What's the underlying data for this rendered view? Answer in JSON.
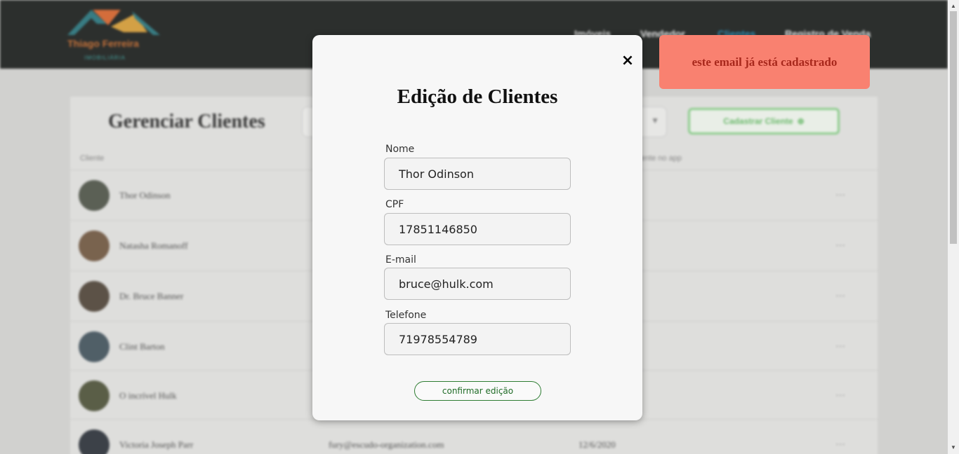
{
  "header": {
    "logo_text": "Thiago Ferreira",
    "logo_sub": "IMOBILIÁRIA",
    "nav": [
      {
        "label": "Imóveis",
        "active": false
      },
      {
        "label": "Vendedor",
        "active": false
      },
      {
        "label": "Clientes",
        "active": true
      },
      {
        "label": "Registro de Venda",
        "active": false
      }
    ]
  },
  "page": {
    "title": "Gerenciar Clientes",
    "add_button": "Cadastrar Cliente",
    "columns": [
      "Cliente",
      "",
      "Cliente no app"
    ]
  },
  "clients": [
    {
      "name": "Thor Odinson",
      "email": "",
      "date": ""
    },
    {
      "name": "Natasha Romanoff",
      "email": "",
      "date": ""
    },
    {
      "name": "Dr. Bruce Banner",
      "email": "",
      "date": ""
    },
    {
      "name": "Clint Barton",
      "email": "",
      "date": ""
    },
    {
      "name": "O incrível Hulk",
      "email": "",
      "date": ""
    },
    {
      "name": "Victoria Joseph Parr",
      "email": "fury@escudo-organization.com",
      "date": "12/6/2020"
    }
  ],
  "modal": {
    "close": "×",
    "title": "Edição de Clientes",
    "fields": {
      "nome": {
        "label": "Nome",
        "value": "Thor Odinson"
      },
      "cpf": {
        "label": "CPF",
        "value": "17851146850"
      },
      "email": {
        "label": "E-mail",
        "value": "bruce@hulk.com"
      },
      "telefone": {
        "label": "Telefone",
        "value": "71978554789"
      }
    },
    "confirm_button": "confirmar edição"
  },
  "toast": {
    "message": "este email já está cadastrado",
    "background": "#f98170",
    "text_color": "#a8281c"
  },
  "colors": {
    "topbar": "#2d302e",
    "nav_active": "#2f8fb5",
    "confirm": "#2e7d32"
  }
}
